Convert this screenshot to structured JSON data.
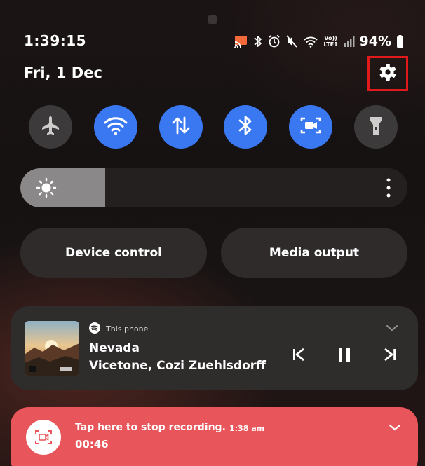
{
  "status_bar": {
    "time": "1:39:15",
    "battery": "94%",
    "network_label": "Vo)) LTE1",
    "icons": [
      "cast-icon",
      "bluetooth-icon",
      "alarm-icon",
      "mute-icon",
      "wifi-icon",
      "signal-icon",
      "battery-icon"
    ]
  },
  "header": {
    "date": "Fri, 1 Dec",
    "settings_icon": "gear-icon"
  },
  "quick_tiles": [
    {
      "name": "airplane-mode",
      "icon": "airplane-icon",
      "state": "off"
    },
    {
      "name": "wifi",
      "icon": "wifi-icon",
      "state": "on"
    },
    {
      "name": "mobile-data",
      "icon": "data-arrows-icon",
      "state": "on"
    },
    {
      "name": "bluetooth",
      "icon": "bluetooth-icon",
      "state": "on"
    },
    {
      "name": "screen-recorder",
      "icon": "screen-record-icon",
      "state": "on"
    },
    {
      "name": "flashlight",
      "icon": "flashlight-icon",
      "state": "off"
    }
  ],
  "brightness": {
    "level": 0.22,
    "icon": "sun-icon",
    "more_icon": "more-vertical-icon"
  },
  "buttons": {
    "device_control": "Device control",
    "media_output": "Media output"
  },
  "media": {
    "source": "This phone",
    "source_icon": "spotify-icon",
    "track": "Nevada",
    "artist": "Vicetone, Cozi Zuehlsdorff",
    "controls": [
      "previous-icon",
      "pause-icon",
      "next-icon"
    ]
  },
  "recording": {
    "title": "Tap here to stop recording.",
    "time": "1:38 am",
    "duration": "00:46"
  },
  "colors": {
    "accent": "#3a78f2",
    "tile_off": "#3c3a3a",
    "highlight": "#e01a1a",
    "recording": "#e8555a"
  }
}
